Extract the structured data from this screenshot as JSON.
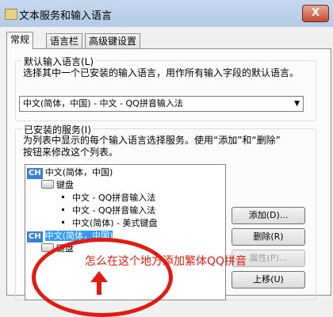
{
  "window": {
    "title": "文本服务和输入语言",
    "close_glyph": "X"
  },
  "tabs": [
    {
      "label": "常规",
      "active": true
    },
    {
      "label": "语言栏",
      "active": false
    },
    {
      "label": "高级键设置",
      "active": false
    }
  ],
  "default_language": {
    "legend": "默认输入语言(L)",
    "description": "选择其中一个已安装的输入语言，用作所有输入字段的默认语言。",
    "selected_value": "中文(简体，中国) - 中文 - QQ拼音输入法"
  },
  "installed_services": {
    "legend": "已安装的服务(I)",
    "description_line1": "为列表中显示的每个输入语言选择服务。使用“添加”和“删除”",
    "description_line2": "按钮来修改这个列表。",
    "tree": [
      {
        "badge": "CH",
        "label": "中文(简体，中国)",
        "kind": "language",
        "selected": false
      },
      {
        "label": "键盘",
        "kind": "category"
      },
      {
        "label": "中文 - QQ拼音输入法",
        "kind": "service"
      },
      {
        "label": "中文 - QQ拼音输入法",
        "kind": "service"
      },
      {
        "label": "中文(简体) - 美式键盘",
        "kind": "service"
      },
      {
        "badge": "CH",
        "label": "中文(简体，中国)",
        "kind": "language",
        "selected": true
      },
      {
        "label": "键盘",
        "kind": "category"
      }
    ],
    "buttons": {
      "add": "添加(D)...",
      "remove": "删除(R)",
      "properties": "属性(P)...",
      "move_up": "上移(U)"
    }
  },
  "annotation": {
    "text": "怎么在这个地方添加繁体QQ拼音",
    "color": "#e11b10"
  },
  "colors": {
    "selection": "#3399ff",
    "badge": "#3c7fd6",
    "titlebar": "#b3cbe6"
  }
}
